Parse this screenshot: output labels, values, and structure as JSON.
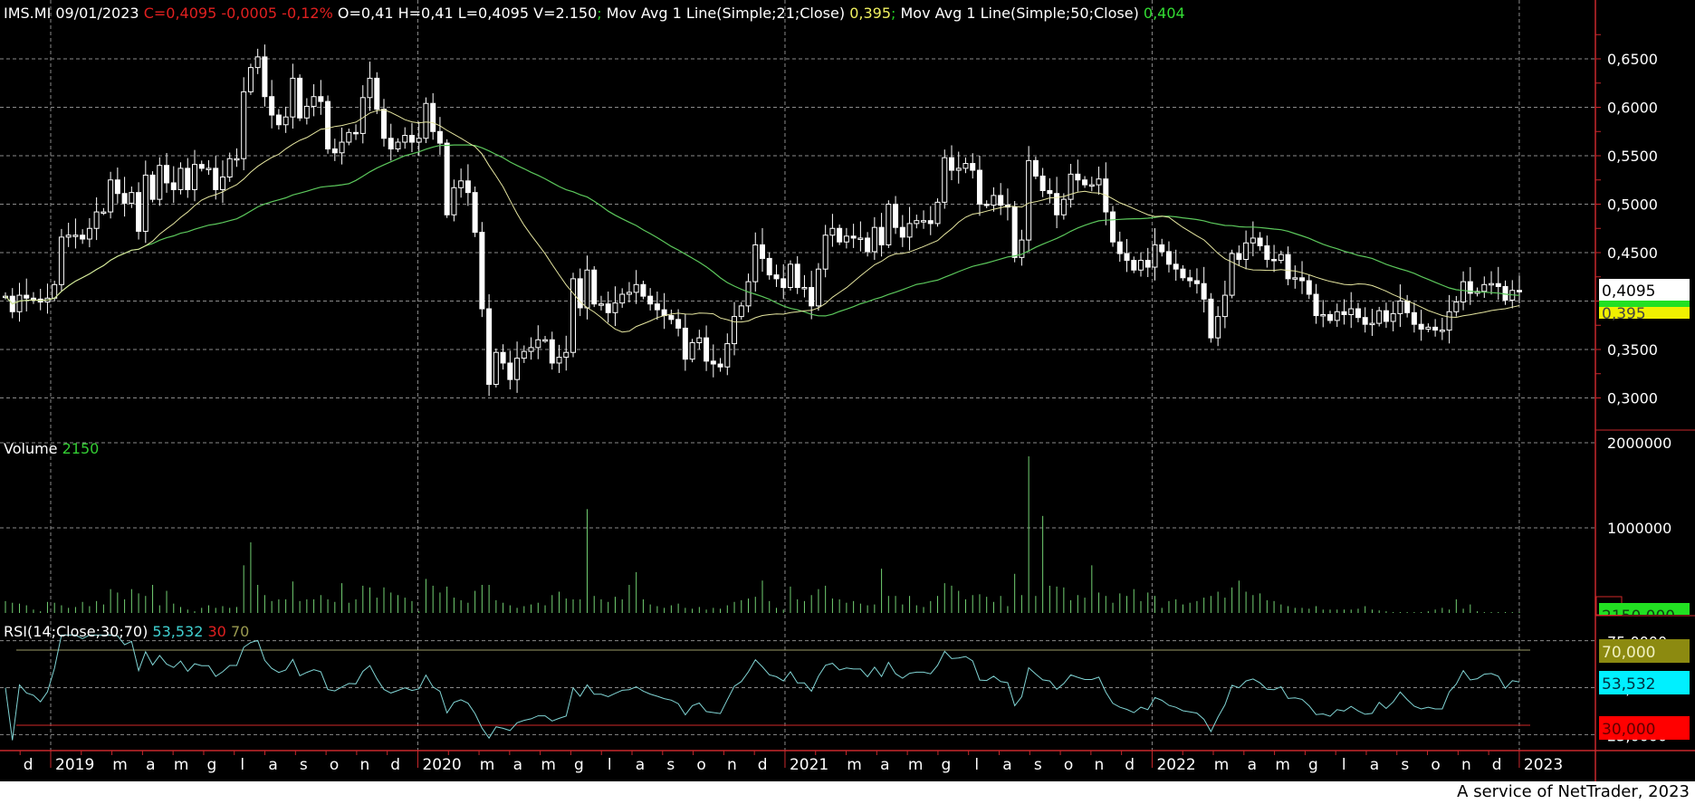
{
  "header": {
    "symbol_date": "IMS.MI 09/01/2023",
    "change": "C=0,4095 -0,0005 -0,12%",
    "ohlcv": "O=0,41 H=0,41 L=0,4095 V=2.150",
    "sep": ";",
    "ma21_label": "Mov Avg 1 Line(Simple;21;Close)",
    "ma21_value": "0,395",
    "ma50_label": "Mov Avg 1 Line(Simple;50;Close)",
    "ma50_value": "0,404"
  },
  "price_axis": {
    "labels": [
      {
        "text": "0,6500",
        "v": 0.65
      },
      {
        "text": "0,6000",
        "v": 0.6
      },
      {
        "text": "0,5500",
        "v": 0.55
      },
      {
        "text": "0,5000",
        "v": 0.5
      },
      {
        "text": "0,4500",
        "v": 0.45
      },
      {
        "text": "0,3500",
        "v": 0.35
      },
      {
        "text": "0,3000",
        "v": 0.3
      }
    ],
    "last_price_badge": "0,4095",
    "ma_badge": "0,395"
  },
  "volume_panel": {
    "label": "Volume",
    "value": "2150",
    "axis": [
      {
        "text": "2000000",
        "v": 2000
      },
      {
        "text": "1000000",
        "v": 1000
      }
    ],
    "badge": "2150,000"
  },
  "rsi_panel": {
    "label": "RSI(14;Close;30;70)",
    "value": "53,532",
    "low": "30",
    "high": "70",
    "axis": [
      {
        "text": "75,0000",
        "v": 75
      },
      {
        "text": "50,0000",
        "v": 50
      },
      {
        "text": "25,0000",
        "v": 25
      }
    ],
    "badge_high": "70,000",
    "badge_current": "53,532",
    "badge_low": "30,000"
  },
  "footer": "A service of NetTrader, 2023",
  "colors": {
    "background": "#000000",
    "candle": "#ffffff",
    "ma21": "#e6e6a0",
    "ma50": "#5cc85c",
    "volume": "#72d072",
    "rsi": "#80d4d4",
    "rsi_high_line": "#9a9a66",
    "rsi_low_line": "#d02828",
    "axis": "#c8282c",
    "change_red": "#e02020",
    "badge_high": "#8c8a10",
    "badge_current": "#00f0ff",
    "badge_low": "#ff0000",
    "badge_volume": "#22e022",
    "badge_ma": "#f0f000"
  },
  "chart_data": {
    "type": "candlestick",
    "interval": "weekly",
    "title": "IMS.MI",
    "ylim": [
      0.28,
      0.69
    ],
    "close": [
      0.405,
      0.389,
      0.406,
      0.403,
      0.402,
      0.399,
      0.403,
      0.417,
      0.466,
      0.468,
      0.468,
      0.464,
      0.475,
      0.492,
      0.492,
      0.525,
      0.511,
      0.501,
      0.512,
      0.472,
      0.53,
      0.505,
      0.54,
      0.522,
      0.515,
      0.537,
      0.515,
      0.541,
      0.537,
      0.537,
      0.515,
      0.528,
      0.547,
      0.547,
      0.616,
      0.641,
      0.652,
      0.611,
      0.592,
      0.582,
      0.59,
      0.63,
      0.589,
      0.601,
      0.611,
      0.606,
      0.557,
      0.553,
      0.564,
      0.574,
      0.573,
      0.61,
      0.63,
      0.598,
      0.568,
      0.557,
      0.564,
      0.571,
      0.564,
      0.568,
      0.604,
      0.575,
      0.563,
      0.489,
      0.517,
      0.524,
      0.512,
      0.471,
      0.392,
      0.314,
      0.347,
      0.336,
      0.319,
      0.341,
      0.348,
      0.352,
      0.36,
      0.36,
      0.336,
      0.342,
      0.347,
      0.423,
      0.393,
      0.432,
      0.397,
      0.397,
      0.388,
      0.398,
      0.407,
      0.409,
      0.417,
      0.405,
      0.397,
      0.391,
      0.385,
      0.381,
      0.372,
      0.34,
      0.357,
      0.362,
      0.338,
      0.335,
      0.332,
      0.356,
      0.384,
      0.395,
      0.42,
      0.458,
      0.444,
      0.427,
      0.423,
      0.414,
      0.438,
      0.414,
      0.414,
      0.395,
      0.433,
      0.468,
      0.475,
      0.461,
      0.467,
      0.465,
      0.465,
      0.451,
      0.476,
      0.458,
      0.5,
      0.476,
      0.466,
      0.48,
      0.483,
      0.483,
      0.48,
      0.502,
      0.548,
      0.535,
      0.537,
      0.542,
      0.535,
      0.5,
      0.499,
      0.509,
      0.499,
      0.497,
      0.445,
      0.463,
      0.545,
      0.529,
      0.514,
      0.511,
      0.489,
      0.505,
      0.531,
      0.525,
      0.52,
      0.52,
      0.526,
      0.492,
      0.461,
      0.449,
      0.442,
      0.432,
      0.442,
      0.435,
      0.458,
      0.451,
      0.438,
      0.433,
      0.424,
      0.421,
      0.418,
      0.402,
      0.362,
      0.384,
      0.406,
      0.449,
      0.443,
      0.46,
      0.465,
      0.457,
      0.443,
      0.442,
      0.448,
      0.423,
      0.424,
      0.421,
      0.407,
      0.385,
      0.386,
      0.38,
      0.389,
      0.386,
      0.392,
      0.383,
      0.376,
      0.377,
      0.39,
      0.379,
      0.387,
      0.4,
      0.388,
      0.376,
      0.371,
      0.373,
      0.37,
      0.37,
      0.389,
      0.399,
      0.42,
      0.408,
      0.41,
      0.417,
      0.418,
      0.415,
      0.401,
      0.411,
      0.4095
    ],
    "volume_thousands": [
      140,
      120,
      110,
      90,
      40,
      20,
      130,
      120,
      90,
      60,
      70,
      130,
      80,
      140,
      100,
      280,
      240,
      160,
      280,
      230,
      200,
      330,
      90,
      260,
      110,
      70,
      40,
      20,
      60,
      90,
      60,
      80,
      60,
      70,
      560,
      830,
      330,
      210,
      140,
      160,
      160,
      370,
      140,
      160,
      160,
      210,
      160,
      130,
      350,
      120,
      160,
      320,
      300,
      180,
      300,
      240,
      210,
      180,
      140,
      20,
      400,
      320,
      240,
      310,
      180,
      150,
      120,
      260,
      330,
      330,
      150,
      120,
      90,
      60,
      80,
      100,
      120,
      90,
      210,
      250,
      170,
      160,
      160,
      1220,
      200,
      160,
      130,
      190,
      160,
      330,
      480,
      160,
      100,
      80,
      60,
      90,
      110,
      60,
      50,
      70,
      40,
      60,
      50,
      90,
      130,
      150,
      170,
      190,
      380,
      140,
      60,
      40,
      310,
      160,
      140,
      210,
      280,
      320,
      170,
      160,
      120,
      140,
      110,
      90,
      100,
      520,
      200,
      200,
      100,
      200,
      90,
      70,
      140,
      200,
      350,
      320,
      260,
      160,
      210,
      220,
      190,
      130,
      200,
      80,
      460,
      210,
      1840,
      200,
      1140,
      320,
      310,
      300,
      150,
      210,
      180,
      560,
      240,
      200,
      120,
      230,
      200,
      280,
      140,
      240,
      200,
      60,
      140,
      160,
      100,
      120,
      140,
      180,
      200,
      250,
      180,
      300,
      380,
      250,
      210,
      230,
      150,
      140,
      100,
      80,
      60,
      60,
      50,
      80,
      40,
      40,
      40,
      40,
      40,
      50,
      80,
      40,
      30,
      20,
      10,
      10,
      0,
      5,
      10,
      20,
      40,
      60,
      40,
      160,
      50,
      100,
      20,
      10,
      10,
      10,
      10,
      5,
      2
    ],
    "moving_averages": [
      {
        "name": "Mov Avg 1 Line(Simple;21;Close)",
        "period": 21,
        "last": 0.395
      },
      {
        "name": "Mov Avg 1 Line(Simple;50;Close)",
        "period": 50,
        "last": 0.404
      }
    ],
    "rsi": {
      "period": 14,
      "last": 53.532,
      "low": 30,
      "high": 70,
      "ylim": [
        20,
        80
      ]
    },
    "x_axis_labels": [
      {
        "t": "d",
        "m": -1
      },
      {
        "t": "2019",
        "m": 0
      },
      {
        "t": "m",
        "m": 2
      },
      {
        "t": "a",
        "m": 3
      },
      {
        "t": "m",
        "m": 4
      },
      {
        "t": "g",
        "m": 5
      },
      {
        "t": "l",
        "m": 6
      },
      {
        "t": "a",
        "m": 7
      },
      {
        "t": "s",
        "m": 8
      },
      {
        "t": "o",
        "m": 9
      },
      {
        "t": "n",
        "m": 10
      },
      {
        "t": "d",
        "m": 11
      },
      {
        "t": "2020",
        "m": 12
      },
      {
        "t": "m",
        "m": 14
      },
      {
        "t": "a",
        "m": 15
      },
      {
        "t": "m",
        "m": 16
      },
      {
        "t": "g",
        "m": 17
      },
      {
        "t": "l",
        "m": 18
      },
      {
        "t": "a",
        "m": 19
      },
      {
        "t": "s",
        "m": 20
      },
      {
        "t": "o",
        "m": 21
      },
      {
        "t": "n",
        "m": 22
      },
      {
        "t": "d",
        "m": 23
      },
      {
        "t": "2021",
        "m": 24
      },
      {
        "t": "m",
        "m": 26
      },
      {
        "t": "a",
        "m": 27
      },
      {
        "t": "m",
        "m": 28
      },
      {
        "t": "g",
        "m": 29
      },
      {
        "t": "l",
        "m": 30
      },
      {
        "t": "a",
        "m": 31
      },
      {
        "t": "s",
        "m": 32
      },
      {
        "t": "o",
        "m": 33
      },
      {
        "t": "n",
        "m": 34
      },
      {
        "t": "d",
        "m": 35
      },
      {
        "t": "2022",
        "m": 36
      },
      {
        "t": "m",
        "m": 38
      },
      {
        "t": "a",
        "m": 39
      },
      {
        "t": "m",
        "m": 40
      },
      {
        "t": "g",
        "m": 41
      },
      {
        "t": "l",
        "m": 42
      },
      {
        "t": "a",
        "m": 43
      },
      {
        "t": "s",
        "m": 44
      },
      {
        "t": "o",
        "m": 45
      },
      {
        "t": "n",
        "m": 46
      },
      {
        "t": "d",
        "m": 47
      },
      {
        "t": "2023",
        "m": 48
      }
    ]
  }
}
